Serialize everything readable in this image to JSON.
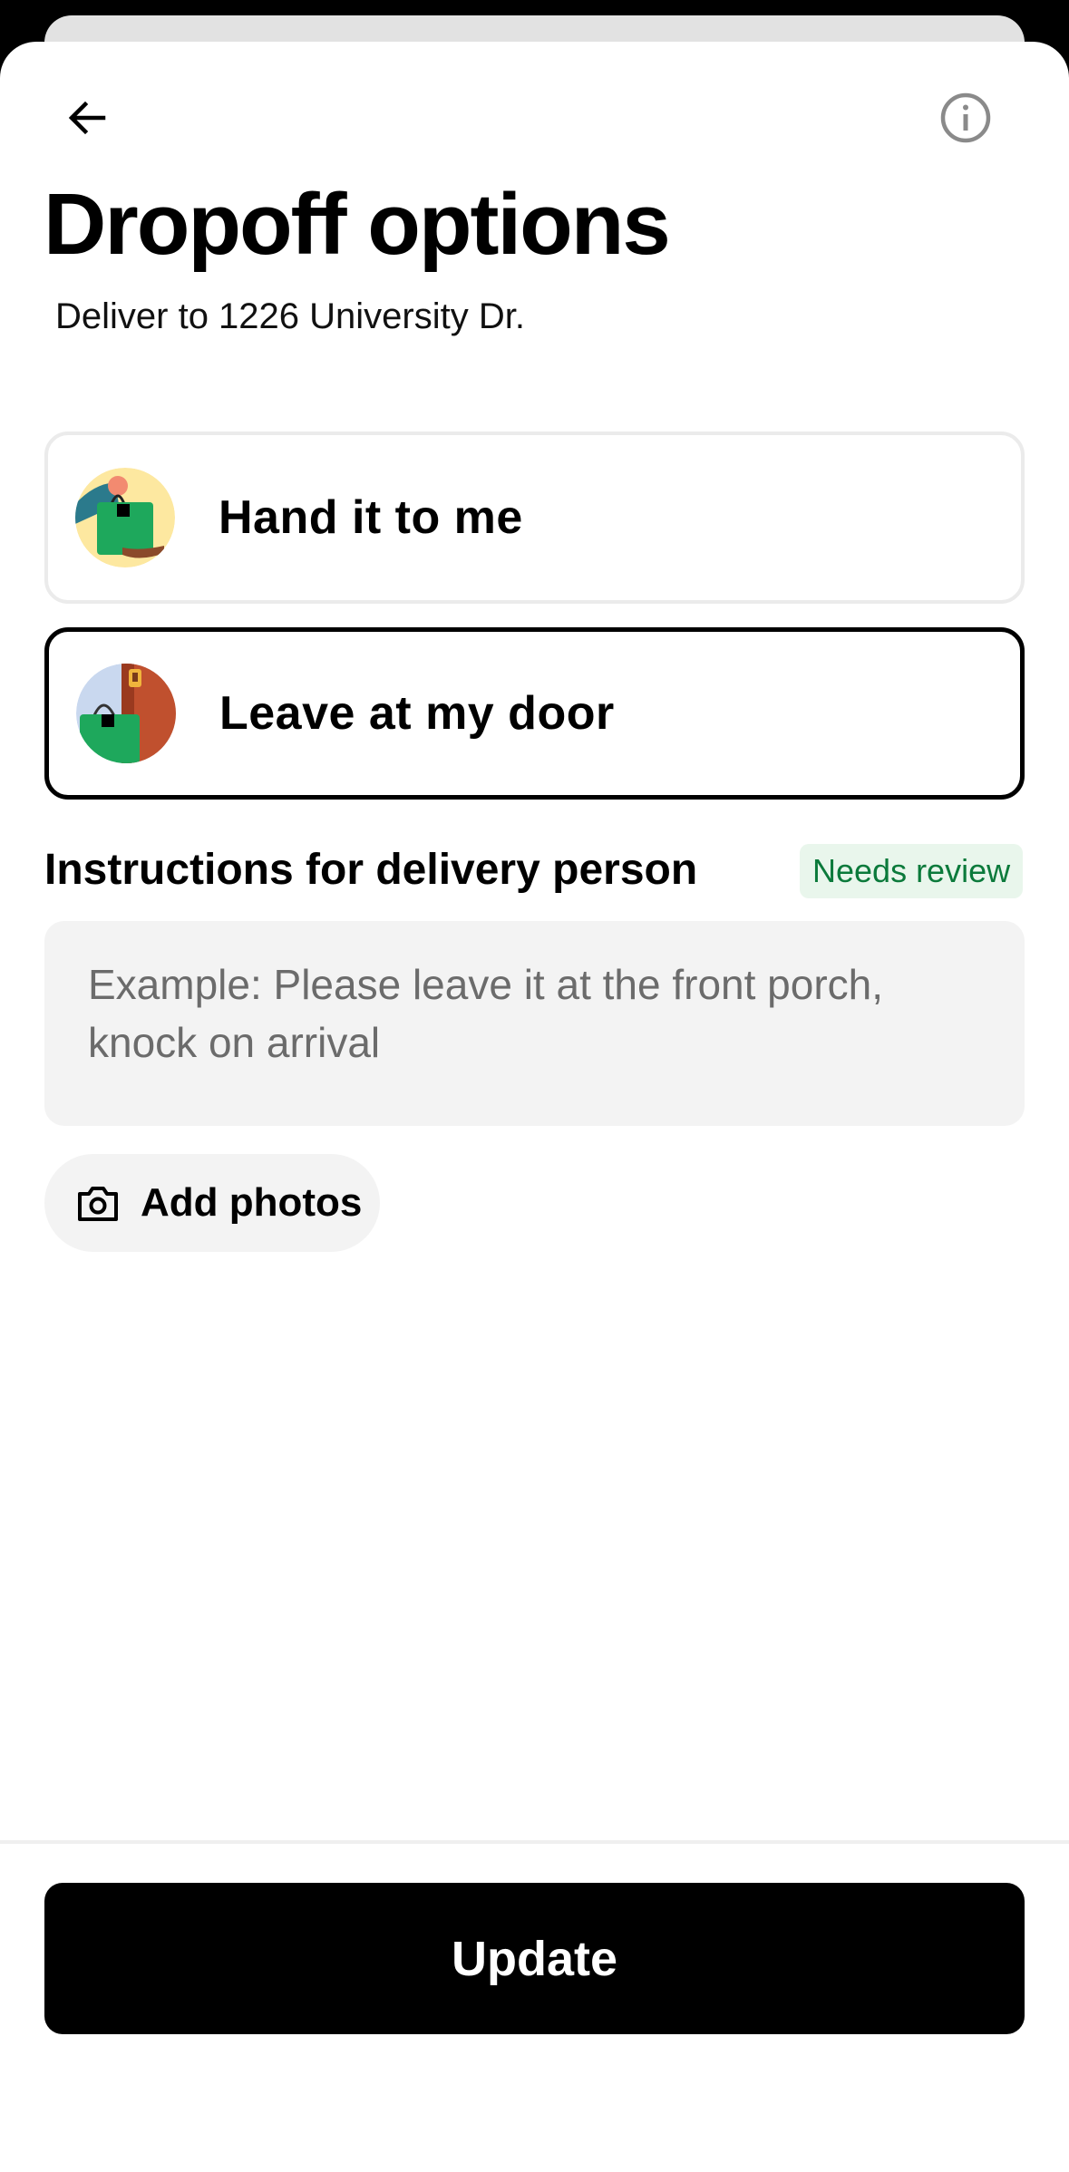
{
  "header": {
    "back_icon": "arrow-left-icon",
    "info_icon": "info-circle-icon"
  },
  "title": "Dropoff options",
  "subtitle": "Deliver to 1226 University Dr.",
  "options": [
    {
      "label": "Hand it to me",
      "icon": "hand-bag-illustration",
      "selected": false
    },
    {
      "label": "Leave at my door",
      "icon": "door-bag-illustration",
      "selected": true
    }
  ],
  "instructions": {
    "label": "Instructions for delivery person",
    "badge": "Needs review",
    "placeholder": "Example: Please leave it at the front porch, knock on arrival",
    "value": ""
  },
  "add_photos": {
    "label": "Add photos",
    "icon": "camera-icon"
  },
  "footer": {
    "button_label": "Update"
  },
  "colors": {
    "selected_border": "#000000",
    "badge_bg": "#e9f6ec",
    "badge_text": "#0b7a3b",
    "field_bg": "#f3f3f3",
    "primary_button_bg": "#000000"
  }
}
